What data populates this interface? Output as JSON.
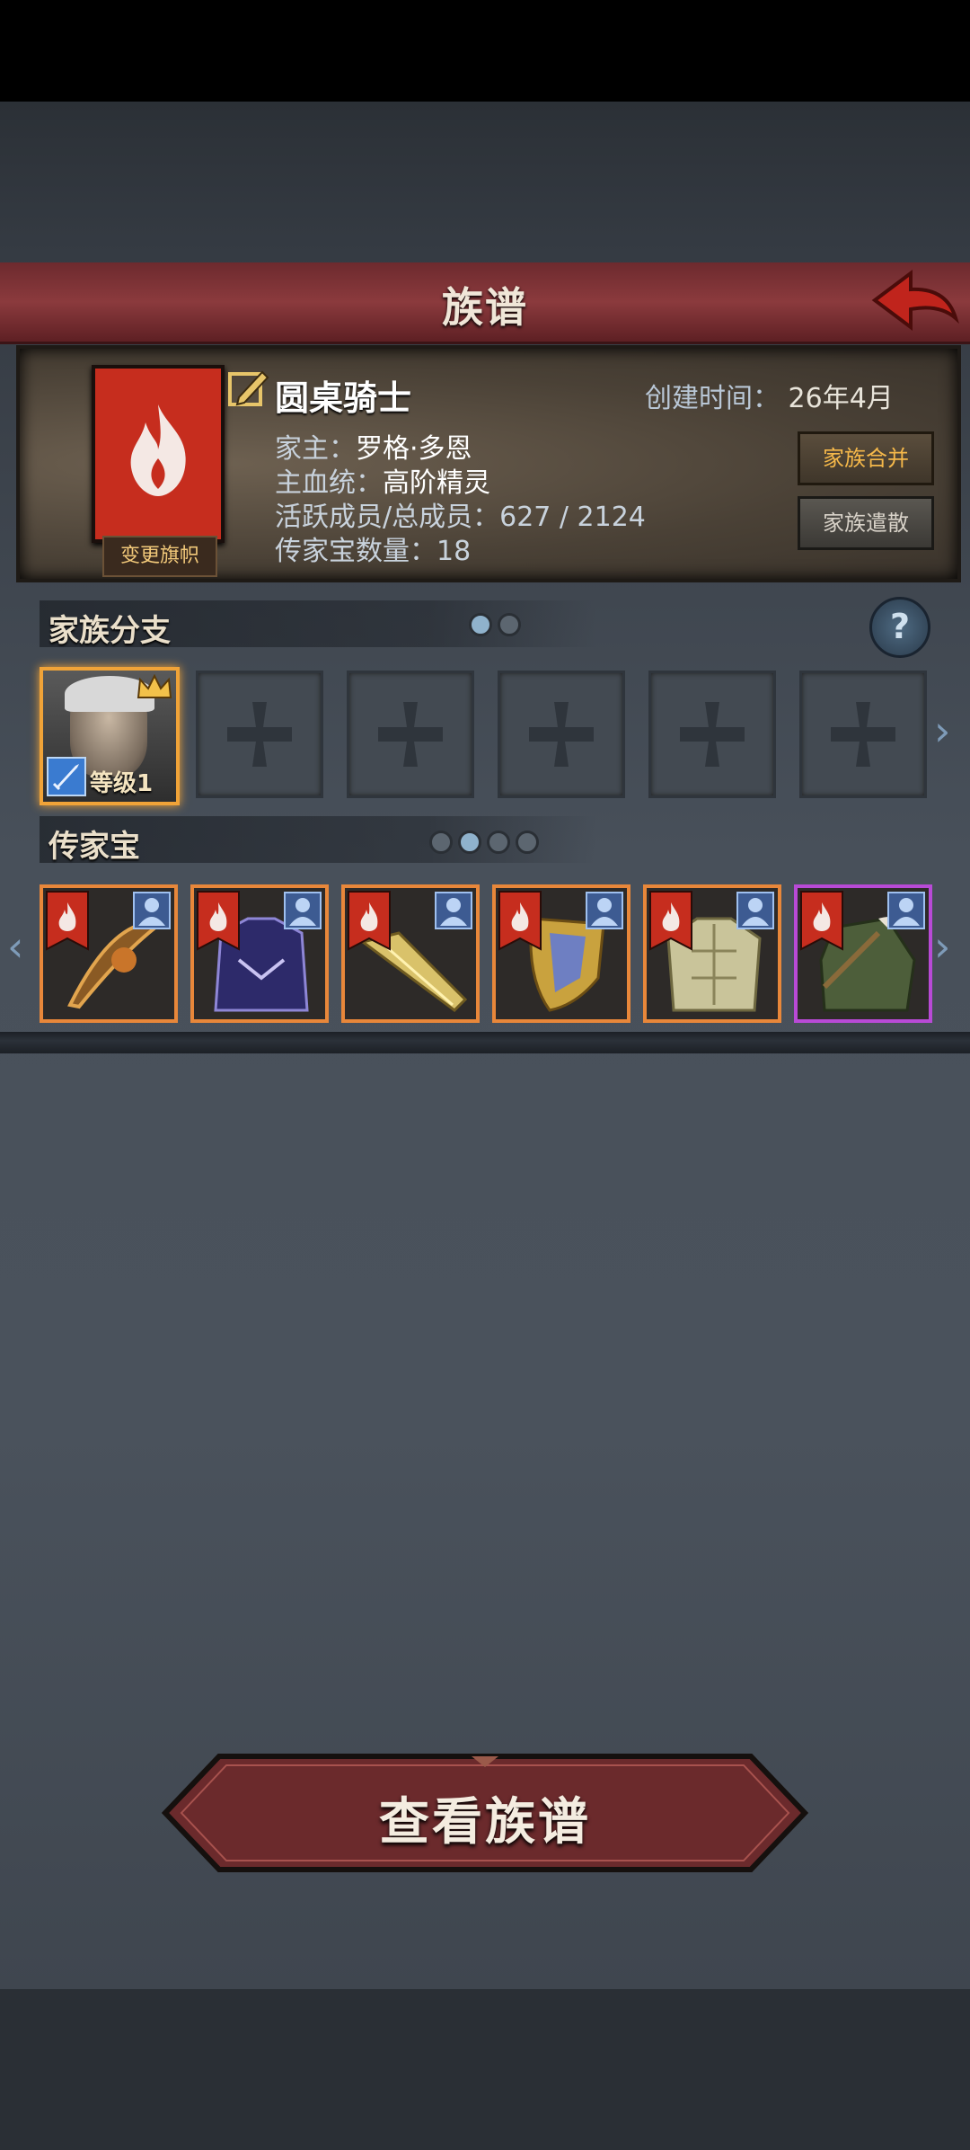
{
  "header": {
    "title": "族谱"
  },
  "clan": {
    "name": "圆桌骑士",
    "created_label": "创建时间：",
    "created_value": "26年4月",
    "leader_label": "家主：",
    "leader_value": "罗格·多恩",
    "bloodline_label": "主血统：",
    "bloodline_value": "高阶精灵",
    "members_label": "活跃成员/总成员：",
    "members_value": "627 / 2124",
    "heirloom_count_label": "传家宝数量：",
    "heirloom_count_value": "18",
    "change_flag_label": "变更旗帜",
    "merge_label": "家族合并",
    "disband_label": "家族遣散"
  },
  "branches": {
    "title": "家族分支",
    "page_count": 2,
    "active_page": 0,
    "help_glyph": "?",
    "leader_level": "等级1",
    "empty_slot_count": 5
  },
  "heirlooms": {
    "title": "传家宝",
    "page_count": 4,
    "active_page": 1,
    "items": [
      {
        "name": "bow-heirloom",
        "rarity": "orange"
      },
      {
        "name": "armor-heirloom",
        "rarity": "orange"
      },
      {
        "name": "sword-heirloom",
        "rarity": "orange"
      },
      {
        "name": "shield-heirloom",
        "rarity": "orange"
      },
      {
        "name": "chestplate-heirloom",
        "rarity": "orange"
      },
      {
        "name": "cloak-heirloom",
        "rarity": "purple"
      }
    ]
  },
  "footer": {
    "view_tree_label": "查看族谱"
  },
  "colors": {
    "accent_red": "#c62d1e",
    "orange_rarity": "#e8873a",
    "purple_rarity": "#b84ad6",
    "gold": "#f0a338"
  }
}
